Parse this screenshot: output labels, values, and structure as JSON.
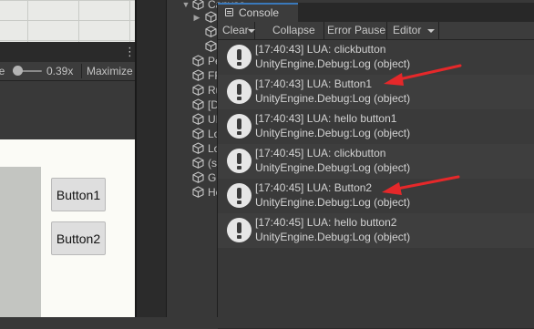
{
  "game_view": {
    "scale_label": "le",
    "scale_value": "0.39x",
    "scale_fraction": 0.39,
    "maximize_label": "Maximize",
    "menu_icon": "kebab-menu-icon",
    "buttons": [
      "Button1",
      "Button2"
    ]
  },
  "hierarchy": {
    "items": [
      {
        "label": "Canvas",
        "expanded": true
      },
      {
        "label": "",
        "expanded": false
      },
      {
        "label": "",
        "expanded": false
      },
      {
        "label": "",
        "expanded": false
      },
      {
        "label": "Pe",
        "expanded": false
      },
      {
        "label": "FF",
        "expanded": false
      },
      {
        "label": "Ru",
        "expanded": false
      },
      {
        "label": "[D",
        "expanded": false
      },
      {
        "label": "UI",
        "expanded": false
      },
      {
        "label": "Lo",
        "expanded": false
      },
      {
        "label": "Lo",
        "expanded": false
      },
      {
        "label": "(s",
        "expanded": false
      },
      {
        "label": "Gl",
        "expanded": false
      },
      {
        "label": "He",
        "expanded": false
      }
    ],
    "item_icon": "gameobject-cube-icon"
  },
  "console": {
    "tab_label": "Console",
    "tab_icon": "console-icon",
    "toolbar": {
      "clear": "Clear",
      "collapse": "Collapse",
      "error_pause": "Error Pause",
      "editor": "Editor"
    },
    "entries": [
      {
        "line1": "[17:40:43] LUA: clickbutton",
        "line2": "UnityEngine.Debug:Log (object)"
      },
      {
        "line1": "[17:40:43] LUA: Button1",
        "line2": "UnityEngine.Debug:Log (object)"
      },
      {
        "line1": "[17:40:43] LUA: hello button1",
        "line2": "UnityEngine.Debug:Log (object)"
      },
      {
        "line1": "[17:40:45] LUA: clickbutton",
        "line2": "UnityEngine.Debug:Log (object)"
      },
      {
        "line1": "[17:40:45] LUA: Button2",
        "line2": "UnityEngine.Debug:Log (object)"
      },
      {
        "line1": "[17:40:45] LUA: hello button2",
        "line2": "UnityEngine.Debug:Log (object)"
      }
    ],
    "entry_icon": "info-log-icon"
  },
  "colors": {
    "annotation_arrow": "#e5282a",
    "editor_bg": "#383838",
    "tab_accent": "#3a79bb"
  }
}
